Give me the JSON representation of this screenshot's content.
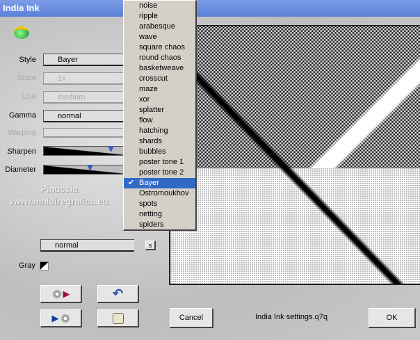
{
  "window": {
    "title": "India Ink"
  },
  "controls": {
    "style": {
      "label": "Style",
      "value": "Bayer"
    },
    "scale": {
      "label": "Scale",
      "value": "1x"
    },
    "line": {
      "label": "Line",
      "value": "medium"
    },
    "gamma": {
      "label": "Gamma",
      "value": "normal"
    },
    "warping": {
      "label": "Warping",
      "value": ""
    },
    "sharpen": {
      "label": "Sharpen",
      "level": 0.78
    },
    "diameter": {
      "label": "Diameter",
      "level": 0.55
    },
    "blend": {
      "value": "normal",
      "s_label": "s"
    },
    "gray": {
      "label": "Gray"
    }
  },
  "watermark": {
    "line1": "Pinuccia",
    "line2": "www.maldiregrafica.eu"
  },
  "menu": {
    "items": [
      "noise",
      "ripple",
      "arabesque",
      "wave",
      "square chaos",
      "round chaos",
      "basketweave",
      "crosscut",
      "maze",
      "xor",
      "splatter",
      "flow",
      "hatching",
      "shards",
      "bubbles",
      "poster tone 1",
      "poster tone 2",
      "Bayer",
      "Ostromoukhov",
      "spots",
      "netting",
      "spiders"
    ],
    "selected": "Bayer",
    "check": "✔"
  },
  "footer": {
    "cancel": "Cancel",
    "settings_file": "India Ink settings.q7q",
    "ok": "OK"
  }
}
